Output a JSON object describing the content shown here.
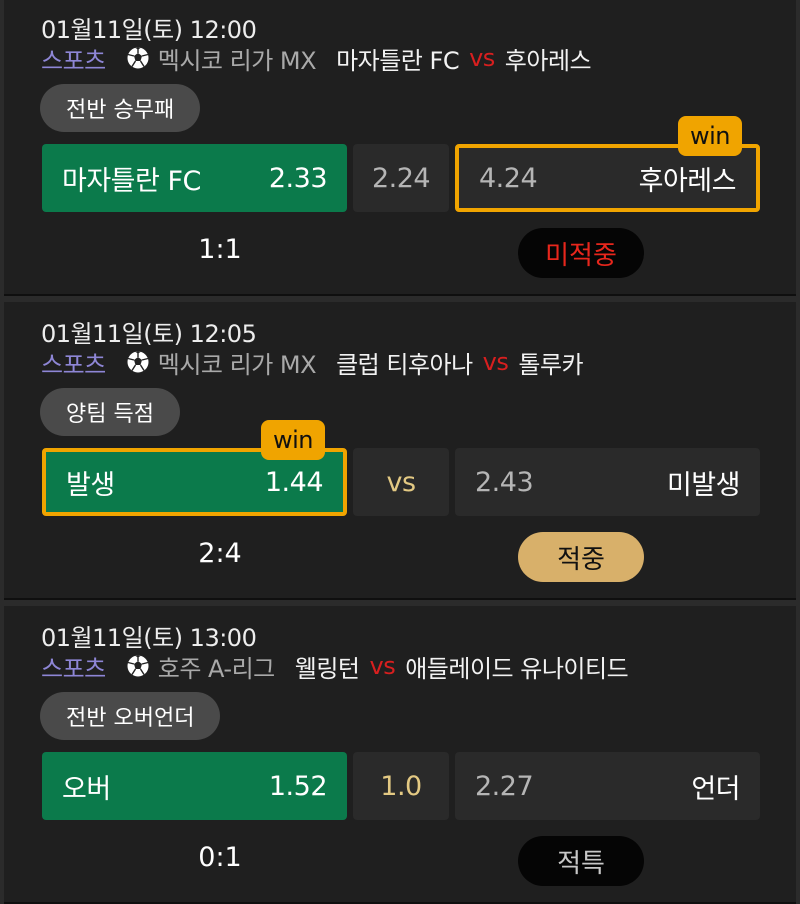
{
  "colors": {
    "sport": "#8e86d6",
    "vs": "#d81f1f",
    "win": "#f0a400",
    "home_bg": "#0b7a4b",
    "hit": "#d8b06a",
    "miss": "#e8261c"
  },
  "bets": [
    {
      "date": "01월11일(토) 12:00",
      "sport": "스포츠",
      "sport_icon": "soccer-ball-icon",
      "league": "멕시코 리가 MX",
      "home_team": "마자틀란 FC",
      "vs": "vs",
      "away_team": "후아레스",
      "bet_type": "전반 승무패",
      "home_label": "마자틀란 FC",
      "home_odds": "2.33",
      "draw_odds": "2.24",
      "away_label": "후아레스",
      "away_odds": "4.24",
      "win_badge": "win",
      "score": "1:1",
      "result": "미적중"
    },
    {
      "date": "01월11일(토) 12:05",
      "sport": "스포츠",
      "sport_icon": "soccer-ball-icon",
      "league": "멕시코 리가 MX",
      "home_team": "클럽 티후아나",
      "vs": "vs",
      "away_team": "톨루카",
      "bet_type": "양팀 득점",
      "home_label": "발생",
      "home_odds": "1.44",
      "draw_odds": "vs",
      "away_label": "미발생",
      "away_odds": "2.43",
      "win_badge": "win",
      "score": "2:4",
      "result": "적중"
    },
    {
      "date": "01월11일(토) 13:00",
      "sport": "스포츠",
      "sport_icon": "soccer-ball-icon",
      "league": "호주 A-리그",
      "home_team": "웰링턴",
      "vs": "vs",
      "away_team": "애들레이드 유나이티드",
      "bet_type": "전반 오버언더",
      "home_label": "오버",
      "home_odds": "1.52",
      "draw_odds": "1.0",
      "away_label": "언더",
      "away_odds": "2.27",
      "score": "0:1",
      "result": "적특"
    }
  ]
}
